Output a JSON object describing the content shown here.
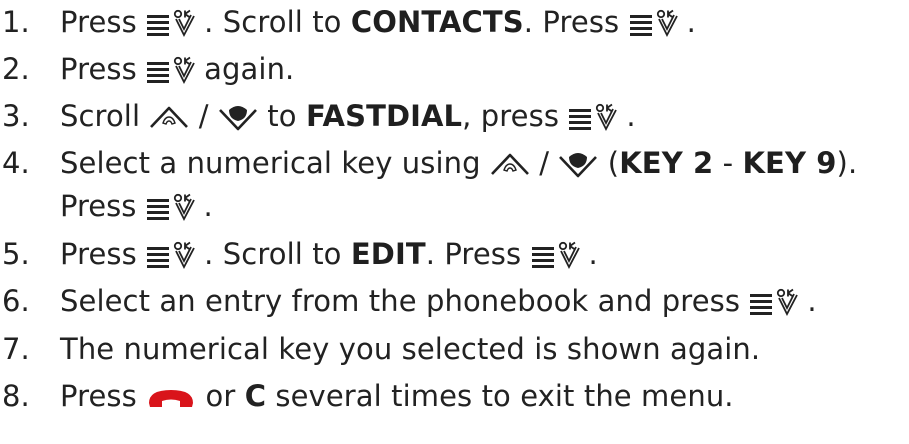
{
  "steps": [
    {
      "n": "1.",
      "a": "Press",
      "b": ". Scroll to",
      "c": "CONTACTS",
      "d": ". Press",
      "e": "."
    },
    {
      "n": "2.",
      "a": "Press",
      "b": "again."
    },
    {
      "n": "3.",
      "a": "Scroll",
      "b": "/",
      "c": "to",
      "d": "FASTDIAL",
      "e": ", press",
      "f": "."
    },
    {
      "n": "4.",
      "a": "Select a numerical key using",
      "b": "/",
      "c": "(",
      "d": "KEY 2",
      "e": " - ",
      "f": "KEY 9",
      "g": ").",
      "h": "Press",
      "i": "."
    },
    {
      "n": "5.",
      "a": "Press",
      "b": ". Scroll to",
      "c": "EDIT",
      "d": ". Press",
      "e": "."
    },
    {
      "n": "6.",
      "a": "Select an entry from the phonebook and press",
      "b": "."
    },
    {
      "n": "7.",
      "a": "The numerical key you selected is shown again."
    },
    {
      "n": "8.",
      "a": "Press",
      "b": "or",
      "c": "C",
      "d": "several times to exit the menu."
    }
  ],
  "icons": {
    "menu_ok": "menu-ok-icon",
    "nav_up": "scroll-up-icon",
    "nav_down": "scroll-down-icon",
    "end_call": "end-call-icon"
  },
  "colors": {
    "text": "#222222",
    "end_call_red": "#d9141b"
  }
}
